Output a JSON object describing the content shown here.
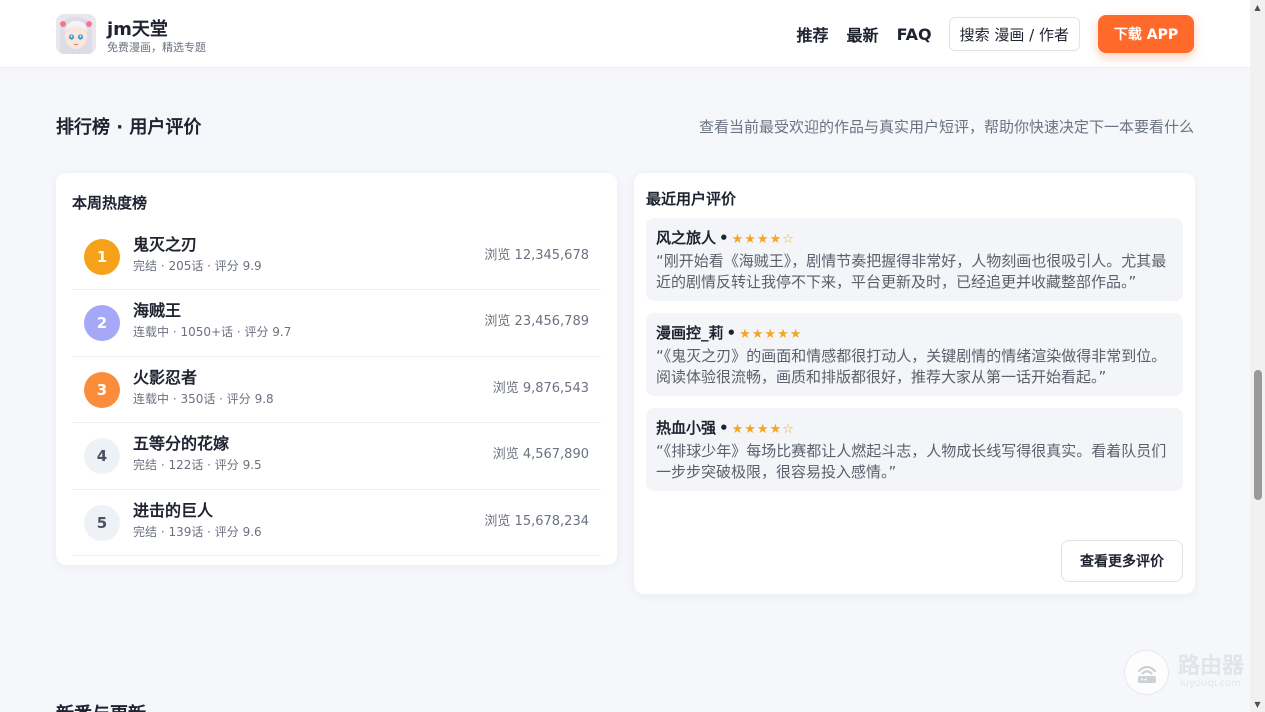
{
  "header": {
    "brand_title": "jm天堂",
    "brand_subtitle": "免费漫画，精选专题",
    "nav": [
      "推荐",
      "最新",
      "FAQ"
    ],
    "search_label": "搜索 漫画 / 作者",
    "app_button": "下载 APP",
    "accent_color": "#ff6a2b"
  },
  "section": {
    "title": "排行榜 · 用户评价",
    "description": "查看当前最受欢迎的作品与真实用户短评，帮助你快速决定下一本要看什么"
  },
  "ranking": {
    "title": "本周热度榜",
    "items": [
      {
        "rank": "1",
        "name": "鬼灭之刃",
        "meta": "完结 · 205话 · 评分 9.9",
        "views": "浏览 12,345,678",
        "badge_color": "#f5a11a"
      },
      {
        "rank": "2",
        "name": "海贼王",
        "meta": "连载中 · 1050+话 · 评分 9.7",
        "views": "浏览 23,456,789",
        "badge_color": "#a4a8f6"
      },
      {
        "rank": "3",
        "name": "火影忍者",
        "meta": "连载中 · 350话 · 评分 9.8",
        "views": "浏览 9,876,543",
        "badge_color": "#fb8c3c"
      },
      {
        "rank": "4",
        "name": "五等分的花嫁",
        "meta": "完结 · 122话 · 评分 9.5",
        "views": "浏览 4,567,890",
        "badge_color": "#eef1f6"
      },
      {
        "rank": "5",
        "name": "进击的巨人",
        "meta": "完结 · 139话 · 评分 9.6",
        "views": "浏览 15,678,234",
        "badge_color": "#eef1f6"
      }
    ]
  },
  "reviews": {
    "title": "最近用户评价",
    "items": [
      {
        "user": "风之旅人",
        "rating": 4,
        "stars": "★★★★☆",
        "text": "“刚开始看《海贼王》，剧情节奏把握得非常好，人物刻画也很吸引人。尤其最近的剧情反转让我停不下来，平台更新及时，已经追更并收藏整部作品。”"
      },
      {
        "user": "漫画控_莉",
        "rating": 5,
        "stars": "★★★★★",
        "text": "“《鬼灭之刃》的画面和情感都很打动人，关键剧情的情绪渲染做得非常到位。阅读体验很流畅，画质和排版都很好，推荐大家从第一话开始看起。”"
      },
      {
        "user": "热血小强",
        "rating": 4,
        "stars": "★★★★☆",
        "text": "“《排球少年》每场比赛都让人燃起斗志，人物成长线写得很真实。看着队员们一步步突破极限，很容易投入感情。”"
      }
    ],
    "more_button": "查看更多评价",
    "star_color": "#f5a623"
  },
  "next_section_title": "新番与更新",
  "watermark": {
    "title": "路由器",
    "subtitle": "luyouqi.com"
  }
}
